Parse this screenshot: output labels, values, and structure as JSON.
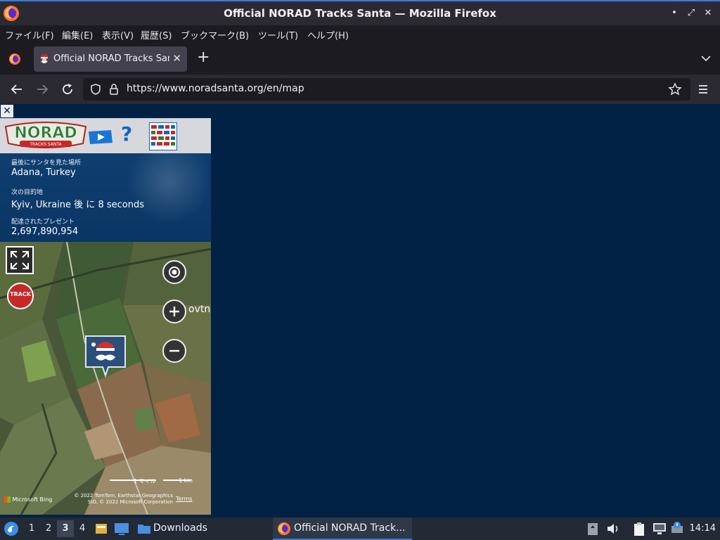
{
  "window": {
    "title": "Official NORAD Tracks Santa — Mozilla Firefox",
    "controls": {
      "minimize": "•",
      "maximize": "⤢",
      "close": "✕"
    }
  },
  "menu": [
    "ファイル(F)",
    "編集(E)",
    "表示(V)",
    "履歴(S)",
    "ブックマーク(B)",
    "ツール(T)",
    "ヘルプ(H)"
  ],
  "tab": {
    "title": "Official NORAD Tracks Santa",
    "close": "✕"
  },
  "newtab": "+",
  "url": "https://www.noradsanta.org/en/map",
  "colors": {
    "page_bg": "#012244",
    "accent": "#3d7ad6",
    "santa_marker": "#2b4e7a",
    "info_bg": "#0a3564"
  },
  "page": {
    "close_label": "✕",
    "last_seen_label": "最後にサンタを見た場所",
    "last_seen_value": "Adana, Turkey",
    "next_label": "次の目的地",
    "next_value": "Kyiv, Ukraine 後 に 8 seconds",
    "gifts_label": "配達されたプレゼント",
    "gifts_value": "2,697,890,954",
    "logo_text": "NORAD",
    "logo_sub": "TRACKS SANTA",
    "help": "?",
    "map_place_label": "ovtne",
    "scale_miles": "1 マイル",
    "scale_km": "1 km",
    "attribution": "© 2022 TomTom, Earthstar Geographics  SIO, © 2022 Microsoft Corporation",
    "terms": "Terms",
    "bing": "Microsoft Bing",
    "track_badge": "TRACK"
  },
  "taskbar": {
    "workspaces": [
      "1",
      "2",
      "3",
      "4"
    ],
    "active_workspace": "3",
    "downloads": "Downloads",
    "firefox_task": "Official NORAD Track...",
    "clock": "14:14"
  }
}
